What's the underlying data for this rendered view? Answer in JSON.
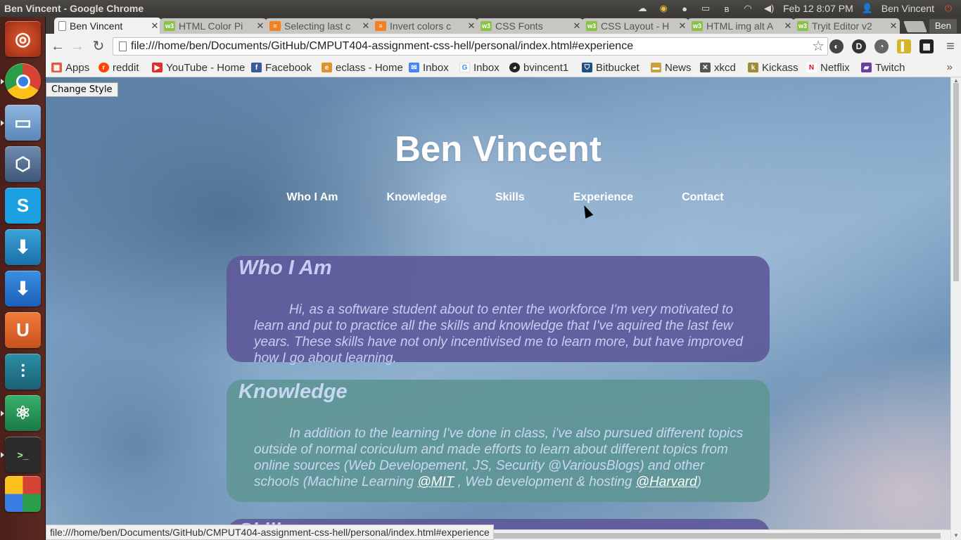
{
  "topbar": {
    "window_title": "Ben Vincent - Google Chrome",
    "datetime": "Feb 12  8:07 PM",
    "user": "Ben Vincent"
  },
  "tabs": [
    {
      "label": "Ben Vincent",
      "icon": "document-icon"
    },
    {
      "label": "HTML Color Pi",
      "icon": "w3-icon"
    },
    {
      "label": "Selecting last c",
      "icon": "stackoverflow-icon"
    },
    {
      "label": "Invert colors c",
      "icon": "stackoverflow-icon"
    },
    {
      "label": "CSS Fonts",
      "icon": "w3-icon"
    },
    {
      "label": "CSS Layout - H",
      "icon": "w3-icon"
    },
    {
      "label": "HTML img alt A",
      "icon": "w3-icon"
    },
    {
      "label": "Tryit Editor v2",
      "icon": "w3-icon"
    }
  ],
  "profile_button": "Ben",
  "toolbar": {
    "url": "file:///home/ben/Documents/GitHub/CMPUT404-assignment-css-hell/personal/index.html#experience"
  },
  "bookmarks": [
    {
      "label": "Apps",
      "icon": "apps-grid-icon",
      "color": "#e45a3c"
    },
    {
      "label": "reddit",
      "icon": "reddit-icon",
      "color": "#ff4500"
    },
    {
      "label": "YouTube - Home",
      "icon": "youtube-icon",
      "color": "#e52d27"
    },
    {
      "label": "Facebook",
      "icon": "facebook-icon",
      "color": "#3b5998"
    },
    {
      "label": "eclass - Home",
      "icon": "eclass-icon",
      "color": "#e0922c"
    },
    {
      "label": "Inbox",
      "icon": "inbox-icon",
      "color": "#4285f4"
    },
    {
      "label": "Inbox",
      "icon": "google-icon",
      "color": "#4285f4"
    },
    {
      "label": "bvincent1",
      "icon": "github-icon",
      "color": "#222222"
    },
    {
      "label": "Bitbucket",
      "icon": "bitbucket-icon",
      "color": "#205081"
    },
    {
      "label": "News",
      "icon": "folder-icon",
      "color": "#c9a13e"
    },
    {
      "label": "xkcd",
      "icon": "xkcd-icon",
      "color": "#555555"
    },
    {
      "label": "Kickass",
      "icon": "kickass-icon",
      "color": "#a08a3c"
    },
    {
      "label": "Netflix",
      "icon": "netflix-icon",
      "color": "#e50914"
    },
    {
      "label": "Twitch",
      "icon": "twitch-icon",
      "color": "#6441a5"
    }
  ],
  "page": {
    "change_style_button": "Change Style",
    "site_name": "Ben Vincent",
    "nav": [
      "Who I Am",
      "Knowledge",
      "Skills",
      "Experience",
      "Contact"
    ],
    "who": {
      "heading": "Who I Am",
      "body": "Hi, as a software student about to enter the workforce I'm very motivated to learn and put to practice all the skills and knowledge that I've aquired the last few years. These skills have not only incentivised me to learn more, but have improved how I go about learning."
    },
    "knowledge": {
      "heading": "Knowledge",
      "body_before": "In addition to the learning I've done in class, i've also pursued different topics outside of normal coriculum and made efforts to learn about different topics from online sources (Web Developement, JS, Security @VariousBlogs) and other schools (Machine Learning ",
      "link_mit": "@MIT",
      "body_middle": " , Web development & hosting ",
      "link_harvard": "@Harvard",
      "body_after": ")"
    },
    "skills": {
      "heading": "Skills"
    }
  },
  "statusbar": {
    "text": "file:///home/ben/Documents/GitHub/CMPUT404-assignment-css-hell/personal/index.html#experience"
  },
  "colors": {
    "section_purple": "#5f5a9b",
    "section_teal": "#609696",
    "heading_text": "#c7cdf2"
  }
}
